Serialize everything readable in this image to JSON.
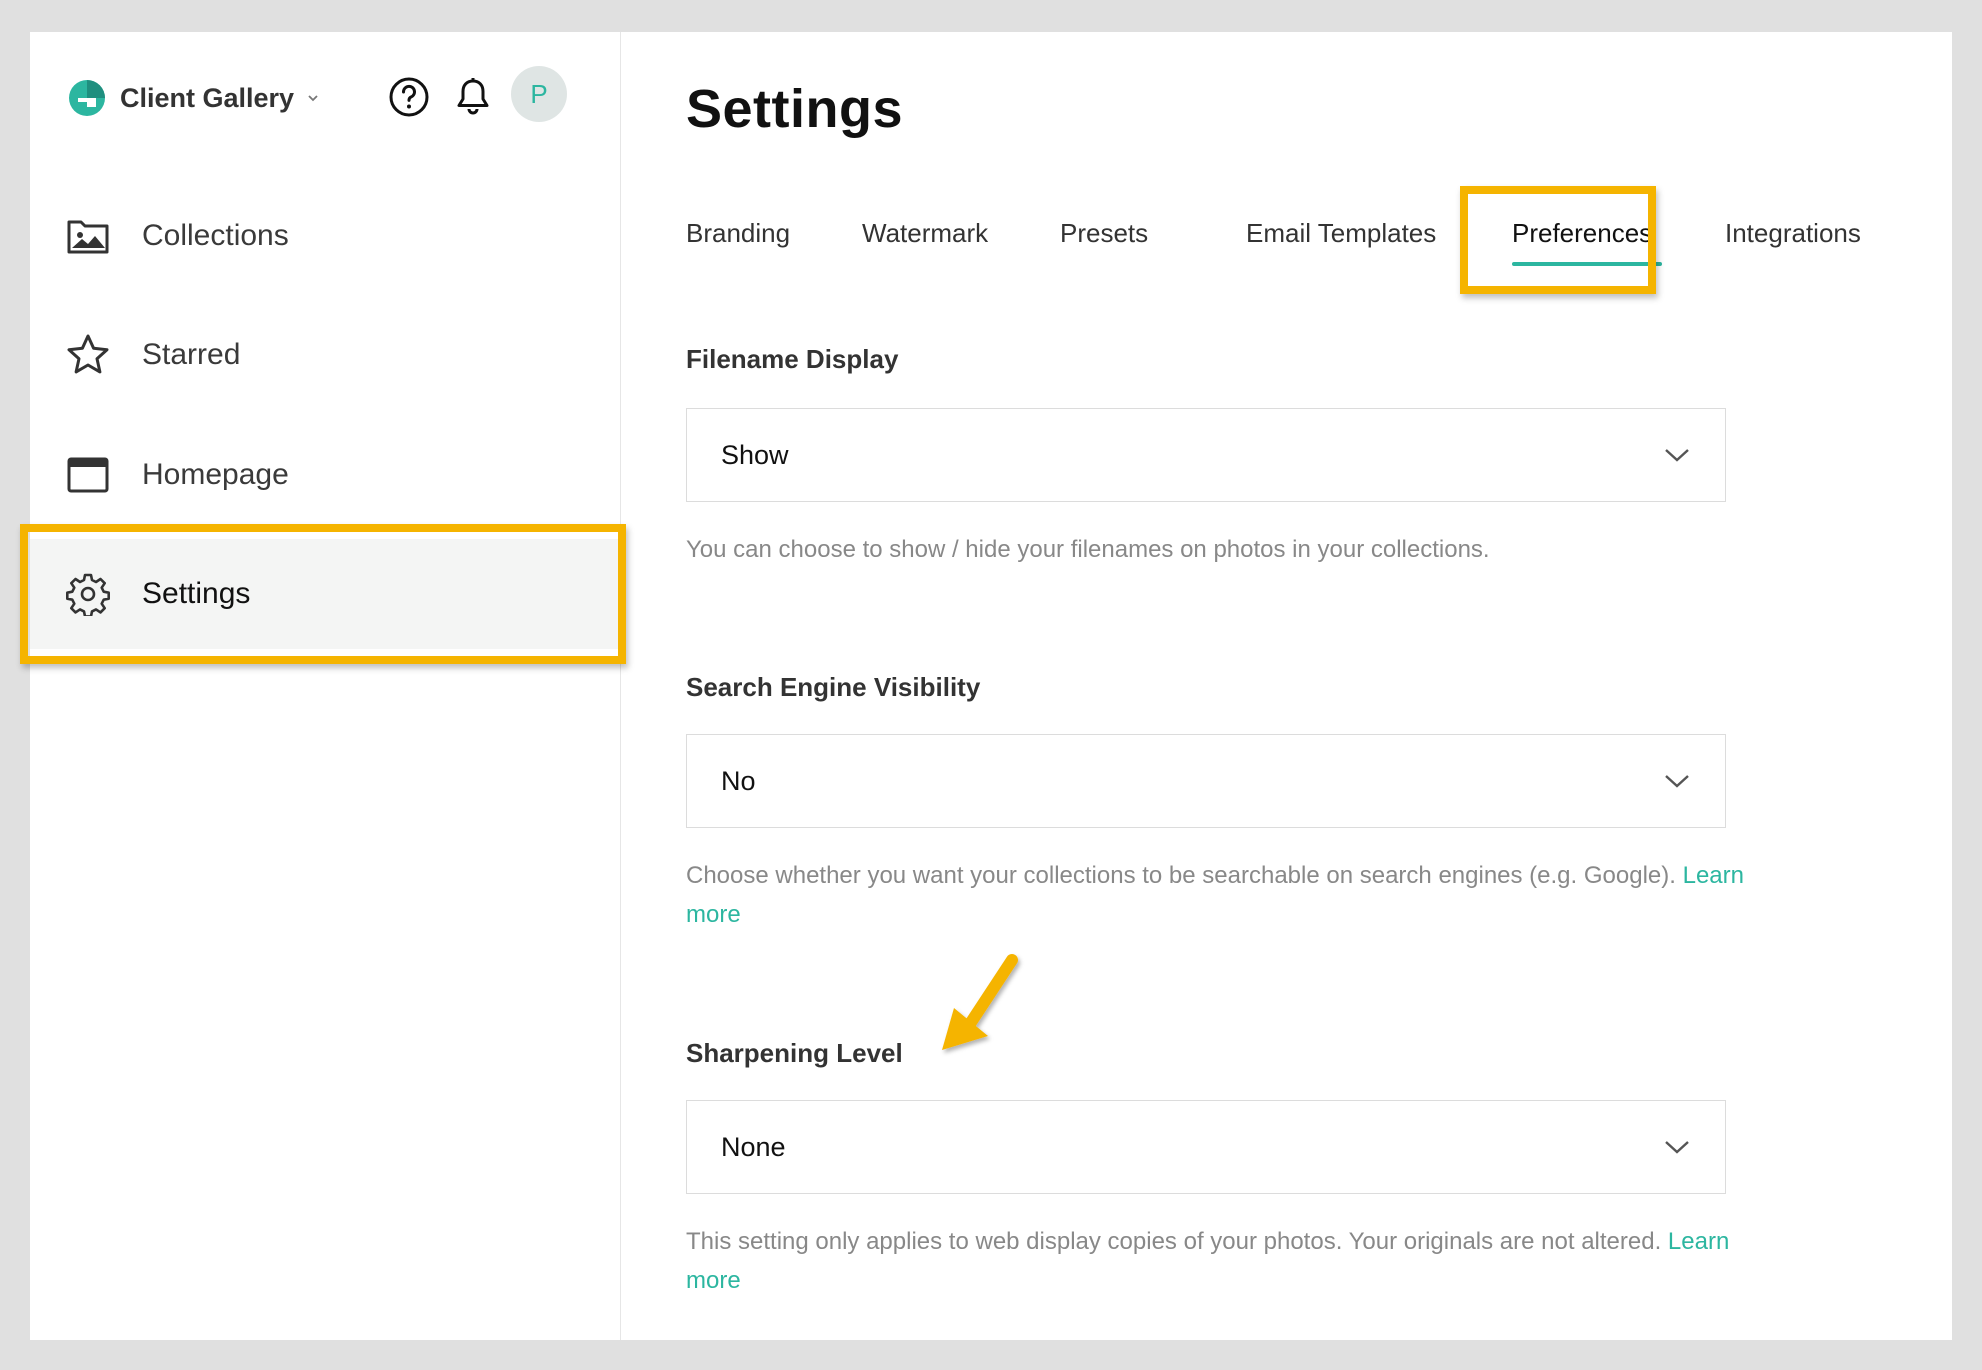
{
  "app": {
    "name": "Client Gallery",
    "avatar_initial": "P"
  },
  "colors": {
    "accent": "#2cb6a0",
    "highlight": "#f5b400"
  },
  "header_icons": [
    "help-icon",
    "bell-icon"
  ],
  "sidebar": {
    "items": [
      {
        "label": "Collections",
        "icon": "image-folder-icon"
      },
      {
        "label": "Starred",
        "icon": "star-icon"
      },
      {
        "label": "Homepage",
        "icon": "browser-window-icon"
      },
      {
        "label": "Settings",
        "icon": "gear-icon",
        "active": true
      }
    ]
  },
  "main": {
    "title": "Settings",
    "tabs": [
      {
        "label": "Branding"
      },
      {
        "label": "Watermark"
      },
      {
        "label": "Presets"
      },
      {
        "label": "Email Templates"
      },
      {
        "label": "Preferences",
        "active": true
      },
      {
        "label": "Integrations"
      }
    ],
    "fields": [
      {
        "label": "Filename Display",
        "value": "Show",
        "help": "You can choose to show / hide your filenames on photos in your collections."
      },
      {
        "label": "Search Engine Visibility",
        "value": "No",
        "help": "Choose whether you want your collections to be searchable on search engines (e.g. Google).",
        "link": "Learn more"
      },
      {
        "label": "Sharpening Level",
        "value": "None",
        "help": "This setting only applies to web display copies of your photos. Your originals are not altered.",
        "link": "Learn more"
      }
    ]
  }
}
